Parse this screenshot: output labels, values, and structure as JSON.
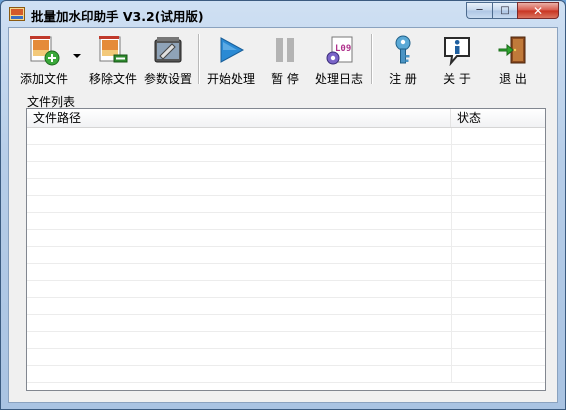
{
  "window": {
    "title": "批量加水印助手 V3.2(试用版)",
    "caption": {
      "minimize": "─",
      "maximize": "□",
      "close": "✕"
    }
  },
  "toolbar": {
    "items": [
      {
        "label": "添加文件",
        "icon": "add-file-icon",
        "has_dropdown": true
      },
      {
        "label": "移除文件",
        "icon": "remove-file-icon"
      },
      {
        "label": "参数设置",
        "icon": "settings-icon"
      },
      {
        "label": "开始处理",
        "icon": "play-icon"
      },
      {
        "label": "暂 停",
        "icon": "pause-icon",
        "disabled": true
      },
      {
        "label": "处理日志",
        "icon": "log-icon"
      },
      {
        "label": "注 册",
        "icon": "key-icon"
      },
      {
        "label": "关 于",
        "icon": "info-icon"
      },
      {
        "label": "退 出",
        "icon": "exit-icon"
      }
    ]
  },
  "file_list": {
    "group_label": "文件列表",
    "columns": [
      "文件路径",
      "状态"
    ],
    "rows": []
  },
  "colors": {
    "accent": "#2a8ad4",
    "close_button": "#c8321f",
    "titlebar": "#b6cde8"
  }
}
